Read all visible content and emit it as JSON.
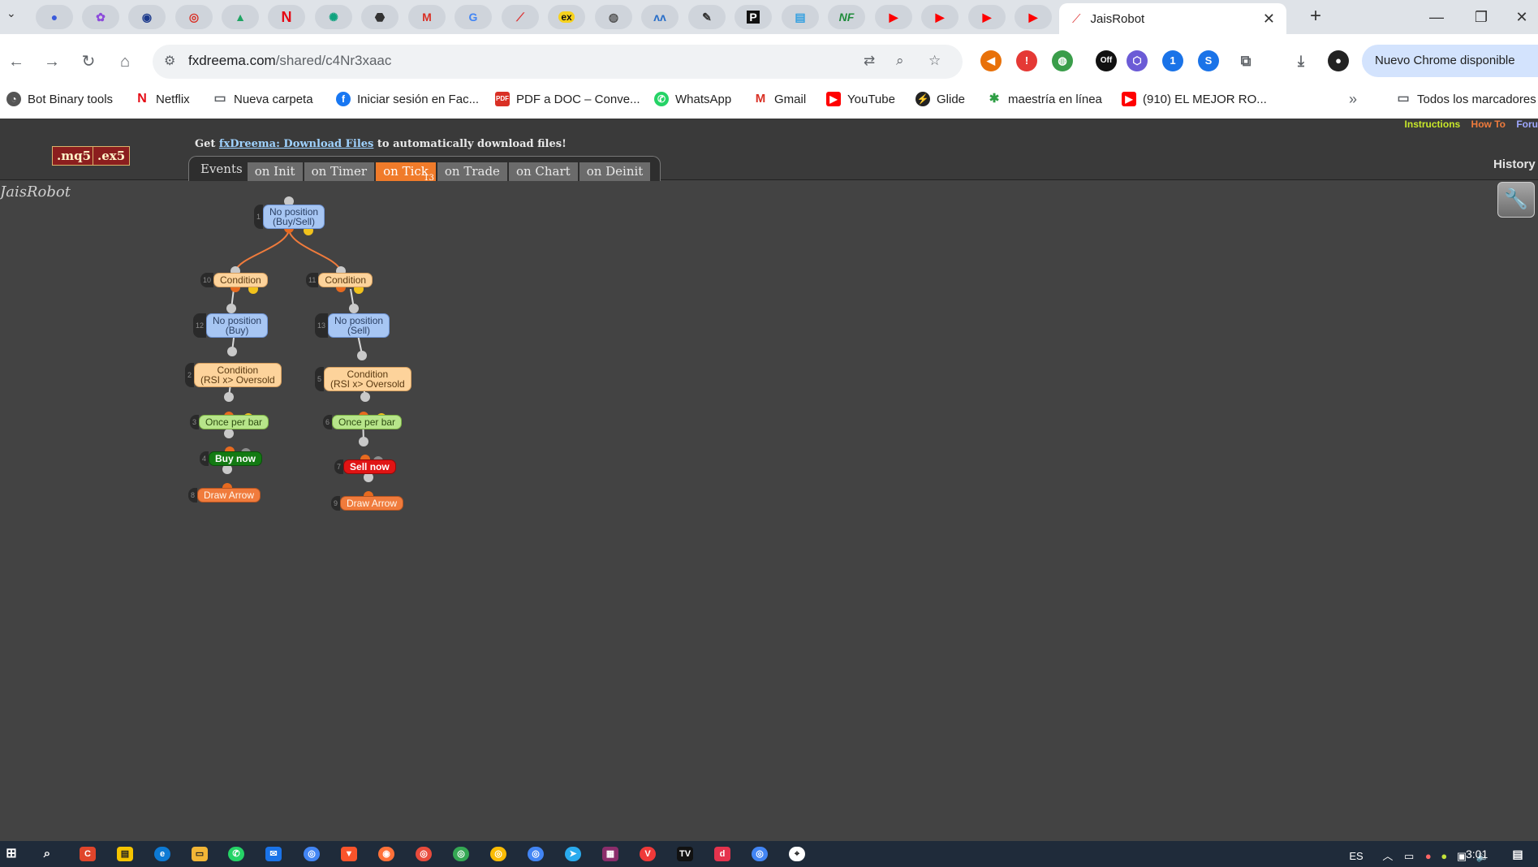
{
  "browser": {
    "tab_title": "JaisRobot",
    "url_domain": "fxdreema.com",
    "url_path": "/shared/c4Nr3xaac",
    "update_chip": "Nuevo Chrome disponible",
    "ext_badge_off": "Off",
    "ext_badge_one": "1",
    "pinned_tabs": [
      "user-circle-icon",
      "pink-badge-icon",
      "eye-icon",
      "chrome-red-icon",
      "drive-icon",
      "netflix-icon",
      "chatgpt-icon",
      "settings-dot-icon",
      "gmail-icon",
      "google-icon",
      "jais-icon",
      "ex-icon",
      "globe-icon",
      "waveform-icon",
      "brush-icon",
      "p-logo-icon",
      "doc-icon",
      "nf-icon",
      "youtube-icon",
      "youtube-icon",
      "youtube-icon",
      "youtube-icon"
    ]
  },
  "bookmarks": {
    "items": [
      "Bot Binary tools",
      "Netflix",
      "Nueva carpeta",
      "Iniciar sesión en Fac...",
      "PDF a DOC – Conve...",
      "WhatsApp",
      "Gmail",
      "YouTube",
      "Glide",
      "maestría en línea",
      "(910) EL MEJOR RO..."
    ],
    "all_bookmarks": "Todos los marcadores"
  },
  "page": {
    "brand": "JaisRobot",
    "side_brand": "fxdreema",
    "mq5_btn": ".mq5",
    "ex5_btn": ".ex5",
    "get_pre": "Get ",
    "get_link": "fxDreema: Download Files",
    "get_post": " to automatically download files!",
    "links": {
      "instructions": "Instructions",
      "howto": "How To",
      "forum": "Foru"
    },
    "history": "History",
    "events_label": "Events",
    "tabs": [
      "on Init",
      "on Timer",
      "on Tick",
      "on Trade",
      "on Chart",
      "on Deinit"
    ],
    "active_tab_count": "13"
  },
  "graph": {
    "nodes": [
      {
        "num": "1",
        "line1": "No position",
        "line2": "(Buy/Sell)"
      },
      {
        "num": "10",
        "line1": "Condition"
      },
      {
        "num": "11",
        "line1": "Condition"
      },
      {
        "num": "12",
        "line1": "No position",
        "line2": "(Buy)"
      },
      {
        "num": "13",
        "line1": "No position",
        "line2": "(Sell)"
      },
      {
        "num": "2",
        "line1": "Condition",
        "line2": "(RSI x> Oversold"
      },
      {
        "num": "5",
        "line1": "Condition",
        "line2": "(RSI x> Oversold"
      },
      {
        "num": "3",
        "line1": "Once per bar"
      },
      {
        "num": "6",
        "line1": "Once per bar"
      },
      {
        "num": "4",
        "line1": "Buy now"
      },
      {
        "num": "7",
        "line1": "Sell now"
      },
      {
        "num": "8",
        "line1": "Draw Arrow"
      },
      {
        "num": "9",
        "line1": "Draw Arrow"
      }
    ]
  },
  "taskbar": {
    "lang": "ES",
    "time": "3:01"
  },
  "colors": {
    "canvas": "#434343",
    "active_tab": "#f07b2a",
    "wire": "#f07b3c"
  }
}
